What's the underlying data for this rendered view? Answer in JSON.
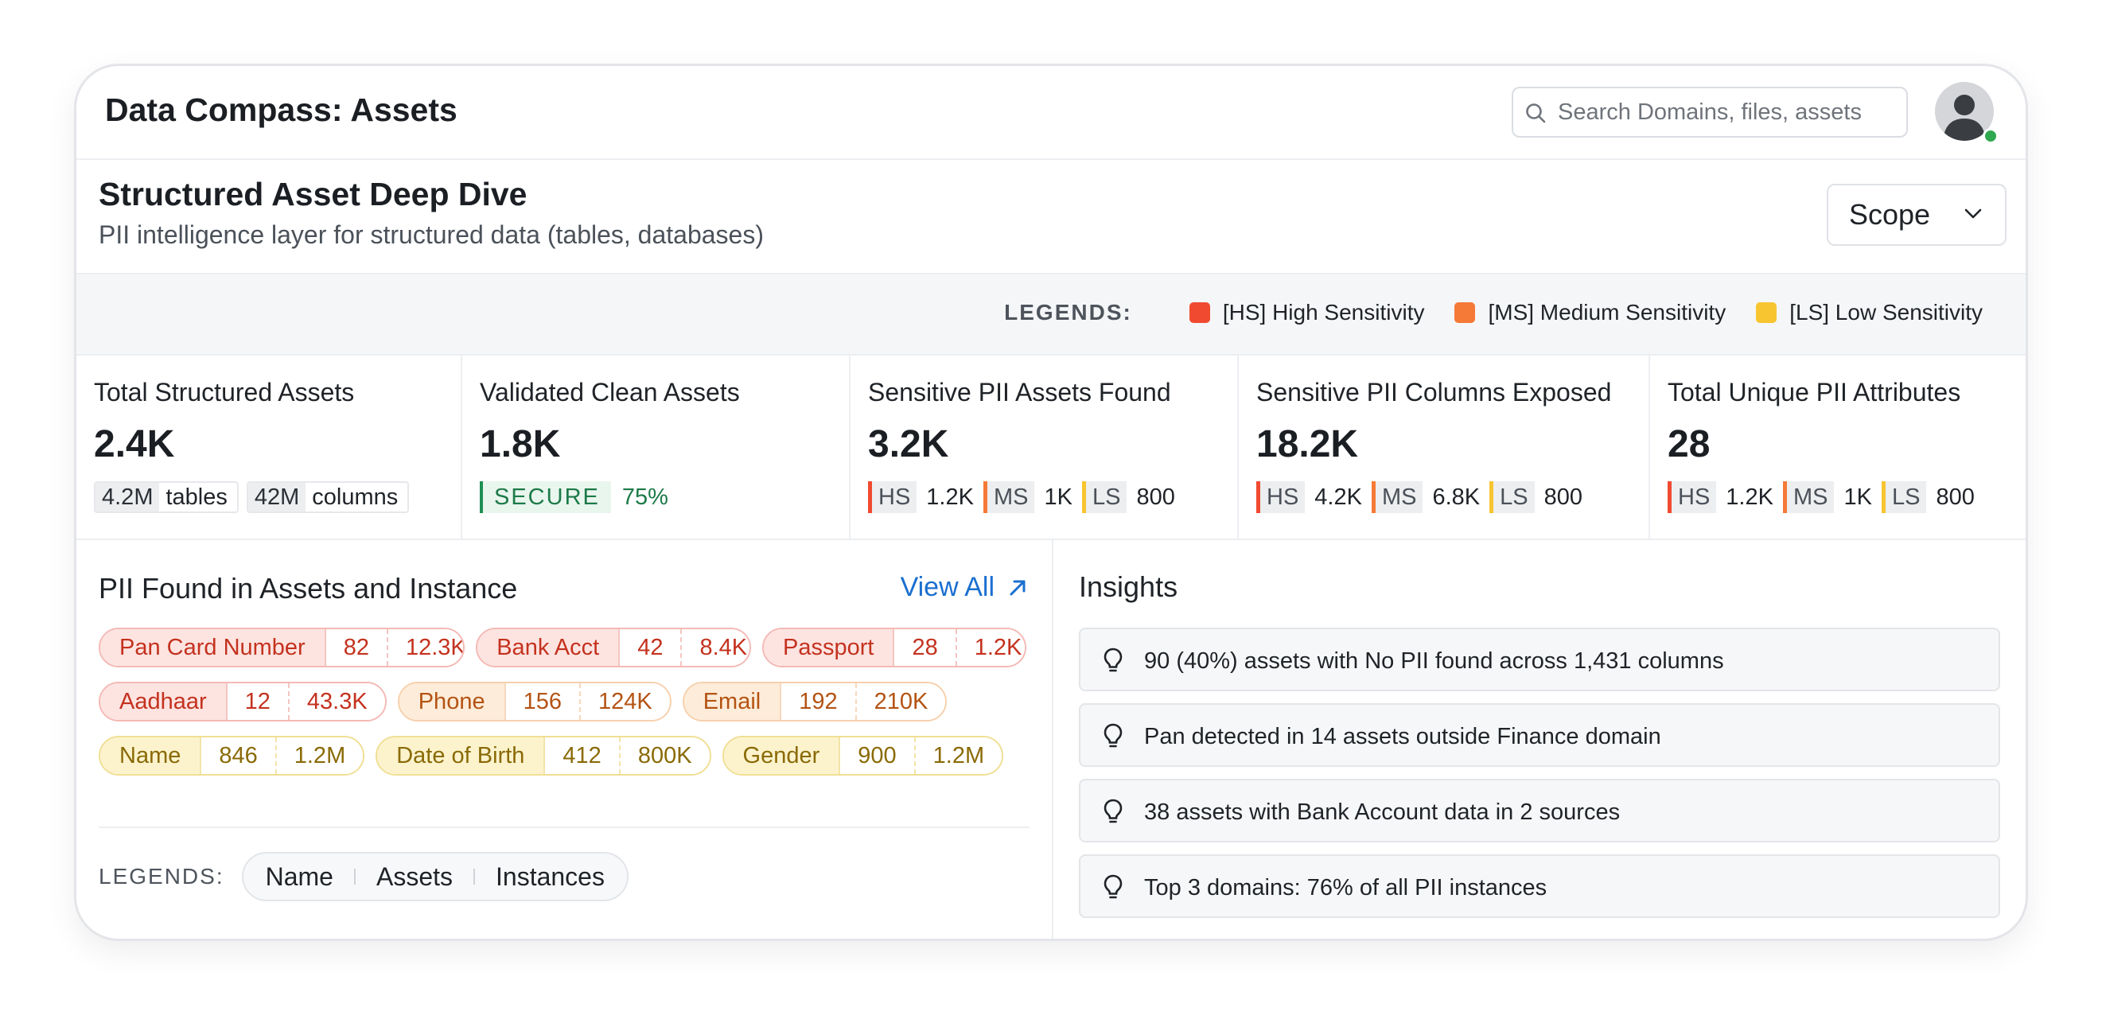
{
  "header": {
    "title": "Data Compass: Assets",
    "search_placeholder": "Search Domains, files, assets"
  },
  "section": {
    "title": "Structured Asset Deep Dive",
    "subtitle": "PII intelligence layer for structured data (tables, databases)",
    "scope_label": "Scope"
  },
  "legend": {
    "label": "LEGENDS:",
    "items": [
      {
        "label": "[HS] High Sensitivity",
        "color": "#f04a30"
      },
      {
        "label": "[MS] Medium Sensitivity",
        "color": "#f57a37"
      },
      {
        "label": "[LS] Low Sensitivity",
        "color": "#f7c530"
      }
    ]
  },
  "stats": {
    "total_structured": {
      "title": "Total Structured Assets",
      "value": "2.4K",
      "tables_n": "4.2M",
      "tables_label": "tables",
      "columns_n": "42M",
      "columns_label": "columns"
    },
    "validated_clean": {
      "title": "Validated Clean Assets",
      "value": "1.8K",
      "tag": "SECURE",
      "pct": "75%"
    },
    "sensitive_assets": {
      "title": "Sensitive PII Assets Found",
      "value": "3.2K",
      "hs": "1.2K",
      "ms": "1K",
      "ls": "800"
    },
    "sensitive_columns": {
      "title": "Sensitive PII Columns Exposed",
      "value": "18.2K",
      "hs": "4.2K",
      "ms": "6.8K",
      "ls": "800"
    },
    "unique_attributes": {
      "title": "Total Unique PII Attributes",
      "value": "28",
      "hs": "1.2K",
      "ms": "1K",
      "ls": "800"
    },
    "codes": {
      "hs": "HS",
      "ms": "MS",
      "ls": "LS"
    }
  },
  "pii": {
    "title": "PII Found in Assets and Instance",
    "view_all": "View All",
    "chips": [
      {
        "name": "Pan Card Number",
        "assets": "82",
        "instances": "12.3K",
        "level": "hs"
      },
      {
        "name": "Bank Acct",
        "assets": "42",
        "instances": "8.4K",
        "level": "hs"
      },
      {
        "name": "Passport",
        "assets": "28",
        "instances": "1.2K",
        "level": "hs"
      },
      {
        "name": "Aadhaar",
        "assets": "12",
        "instances": "43.3K",
        "level": "hs"
      },
      {
        "name": "Phone",
        "assets": "156",
        "instances": "124K",
        "level": "ms"
      },
      {
        "name": "Email",
        "assets": "192",
        "instances": "210K",
        "level": "ms"
      },
      {
        "name": "Name",
        "assets": "846",
        "instances": "1.2M",
        "level": "ls"
      },
      {
        "name": "Date of Birth",
        "assets": "412",
        "instances": "800K",
        "level": "ls"
      },
      {
        "name": "Gender",
        "assets": "900",
        "instances": "1.2M",
        "level": "ls"
      }
    ],
    "legend_label": "LEGENDS:",
    "legend_name": "Name",
    "legend_assets": "Assets",
    "legend_instances": "Instances"
  },
  "insights": {
    "title": "Insights",
    "items": [
      "90 (40%) assets with No PII found across 1,431 columns",
      "Pan detected in 14 assets outside Finance domain",
      "38 assets with Bank Account data in 2 sources",
      "Top 3 domains: 76% of all PII instances"
    ]
  }
}
